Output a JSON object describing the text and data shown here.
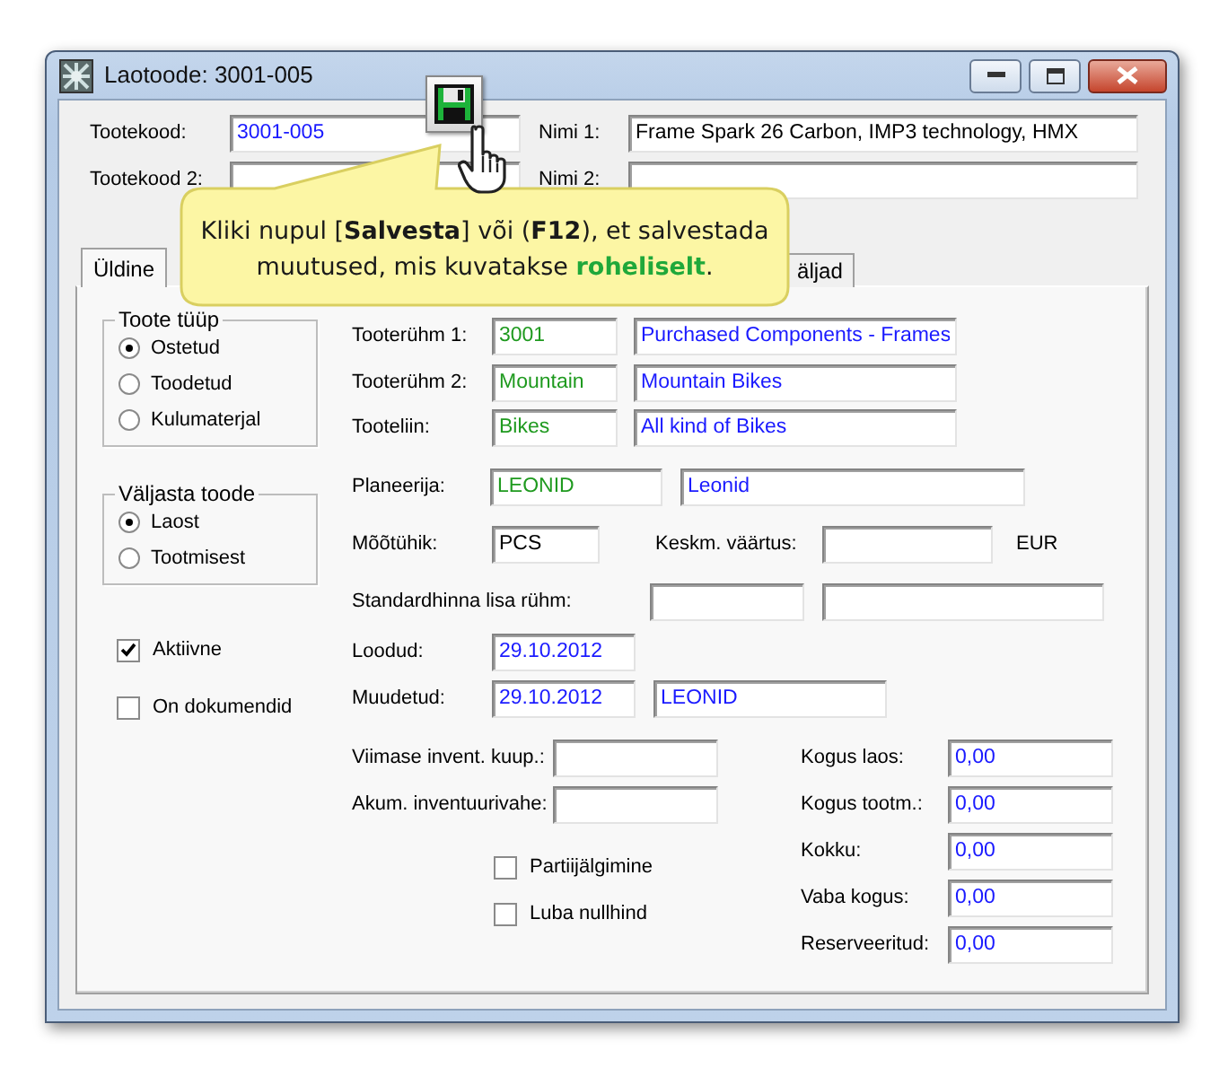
{
  "window": {
    "title": "Laotoode: 3001-005"
  },
  "header": {
    "code": {
      "label": "Tootekood:",
      "value": "3001-005",
      "color": "#1a1aff"
    },
    "name_1": {
      "label": "Nimi 1:",
      "value": "Frame Spark 26 Carbon, IMP3 technology, HMX",
      "color": "#000000"
    },
    "code_2": {
      "label": "Tootekood 2:"
    },
    "name_2": {
      "label": "Nimi 2:"
    }
  },
  "tabs": [
    {
      "label": "Üldine",
      "selected": true
    },
    {
      "label": "äljad",
      "selected": false
    }
  ],
  "product_type": {
    "title": "Toote tüüp",
    "options": [
      {
        "label": "Ostetud",
        "selected": true
      },
      {
        "label": "Toodetud",
        "selected": false
      },
      {
        "label": "Kulumaterjal",
        "selected": false
      }
    ]
  },
  "issue_from": {
    "title": "Väljasta toode",
    "options": [
      {
        "label": "Laost",
        "selected": true
      },
      {
        "label": "Tootmisest",
        "selected": false
      }
    ]
  },
  "flags": [
    {
      "label": "Aktiivne",
      "checked": true
    },
    {
      "label": "On dokumendid",
      "checked": false
    }
  ],
  "groups": [
    {
      "label": "Tooterühm 1:",
      "code": {
        "value": "3001",
        "color": "#1f9a1f"
      },
      "name": {
        "value": "Purchased Components - Frames",
        "color": "#1a1aff"
      }
    },
    {
      "label": "Tooterühm 2:",
      "code": {
        "value": "Mountain",
        "color": "#1f9a1f"
      },
      "name": {
        "value": "Mountain Bikes",
        "color": "#1a1aff"
      }
    },
    {
      "label": "Tooteliin:",
      "code": {
        "value": "Bikes",
        "color": "#1f9a1f"
      },
      "name": {
        "value": "All kind of Bikes",
        "color": "#1a1aff"
      }
    }
  ],
  "planner": {
    "label": "Planeerija:",
    "code": {
      "value": "LEONID",
      "color": "#1f9a1f"
    },
    "name": {
      "value": "Leonid",
      "color": "#1a1aff"
    }
  },
  "unit": {
    "label": "Mõõtühik:",
    "value": "PCS",
    "color": "#000000"
  },
  "avg_value": {
    "label": "Keskm. väärtus:",
    "currency": "EUR"
  },
  "std_price_group": {
    "label": "Standardhinna lisa rühm:"
  },
  "created": {
    "label": "Loodud:",
    "date": {
      "value": "29.10.2012",
      "color": "#1a1aff"
    }
  },
  "modified": {
    "label": "Muudetud:",
    "date": {
      "value": "29.10.2012",
      "color": "#1a1aff"
    },
    "user": {
      "value": "LEONID",
      "color": "#1a1aff"
    }
  },
  "inventory": [
    {
      "label": "Viimase invent. kuup.:"
    },
    {
      "label": "Akum. inventuurivahe:"
    }
  ],
  "options": [
    {
      "label": "Partiijälgimine",
      "checked": false
    },
    {
      "label": "Luba nullhind",
      "checked": false
    }
  ],
  "quantities": [
    {
      "label": "Kogus laos:",
      "value": "0,00",
      "color": "#1a1aff"
    },
    {
      "label": "Kogus tootm.:",
      "value": "0,00",
      "color": "#1a1aff"
    },
    {
      "label": "Kokku:",
      "value": "0,00",
      "color": "#1a1aff"
    },
    {
      "label": "Vaba kogus:",
      "value": "0,00",
      "color": "#1a1aff"
    },
    {
      "label": "Reserveeritud:",
      "value": "0,00",
      "color": "#1a1aff"
    }
  ],
  "callout": {
    "lines": [
      [
        {
          "text": "Kliki nupul [",
          "kind": "plain"
        },
        {
          "text": "Salvesta",
          "kind": "bold"
        },
        {
          "text": "] või (",
          "kind": "plain"
        },
        {
          "text": "F12",
          "kind": "bold"
        },
        {
          "text": "), et salvestada",
          "kind": "plain"
        }
      ],
      [
        {
          "text": "muutused, mis kuvatakse ",
          "kind": "plain"
        },
        {
          "text": "roheliselt",
          "kind": "highlight"
        },
        {
          "text": ".",
          "kind": "plain"
        }
      ]
    ]
  }
}
